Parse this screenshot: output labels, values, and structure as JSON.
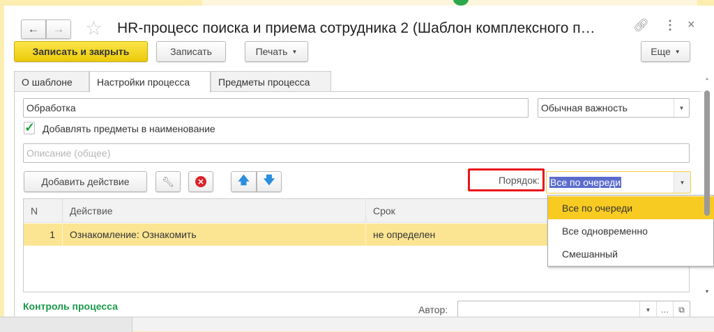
{
  "window": {
    "title": "HR-процесс поиска и приема сотрудника 2 (Шаблон комплексного п…"
  },
  "toolbar": {
    "save_close": "Записать и закрыть",
    "save": "Записать",
    "print": "Печать",
    "more": "Еще"
  },
  "tabs": [
    {
      "label": "О шаблоне"
    },
    {
      "label": "Настройки процесса"
    },
    {
      "label": "Предметы процесса"
    }
  ],
  "form": {
    "name_value": "Обработка",
    "importance_value": "Обычная важность",
    "add_subjects_label": "Добавлять предметы в наименование",
    "add_subjects_checked": true,
    "description_placeholder": "Описание (общее)"
  },
  "actions": {
    "add_action": "Добавить действие",
    "order_label": "Порядок:",
    "order_value": "Все по очереди"
  },
  "table": {
    "headers": [
      "N",
      "Действие",
      "Срок"
    ],
    "rows": [
      {
        "n": "1",
        "action": "Ознакомление: Ознакомить",
        "term": "не определен"
      }
    ]
  },
  "dropdown": {
    "options": [
      "Все по очереди",
      "Все одновременно",
      "Смешанный"
    ],
    "selected": 0
  },
  "footer": {
    "control_title": "Контроль процесса",
    "author_label": "Автор:",
    "author_value": ""
  },
  "colors": {
    "primary_button": "#f5d81f",
    "selected_row": "#fbe593",
    "dropdown_highlight": "#f8cb22",
    "section_title": "#1a9a4a",
    "highlight_box": "#e8141b"
  }
}
